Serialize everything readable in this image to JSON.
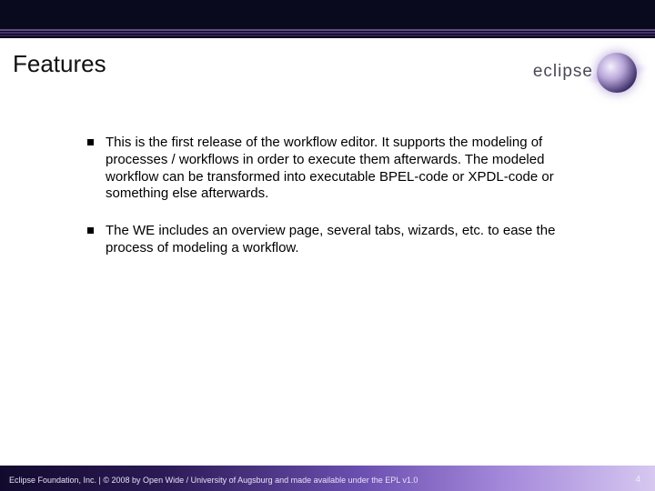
{
  "title": "Features",
  "logo_text": "eclipse",
  "bullets": [
    "This is the first release of the workflow editor. It supports the modeling of processes / workflows in order to execute them afterwards. The modeled workflow can be transformed into executable BPEL-code or XPDL-code or something else afterwards.",
    "The WE includes an overview page, several tabs, wizards, etc. to ease the process of modeling a workflow."
  ],
  "footer": "Eclipse Foundation, Inc. | © 2008 by Open Wide / University of Augsburg and made available under the EPL v1.0",
  "page_number": "4"
}
